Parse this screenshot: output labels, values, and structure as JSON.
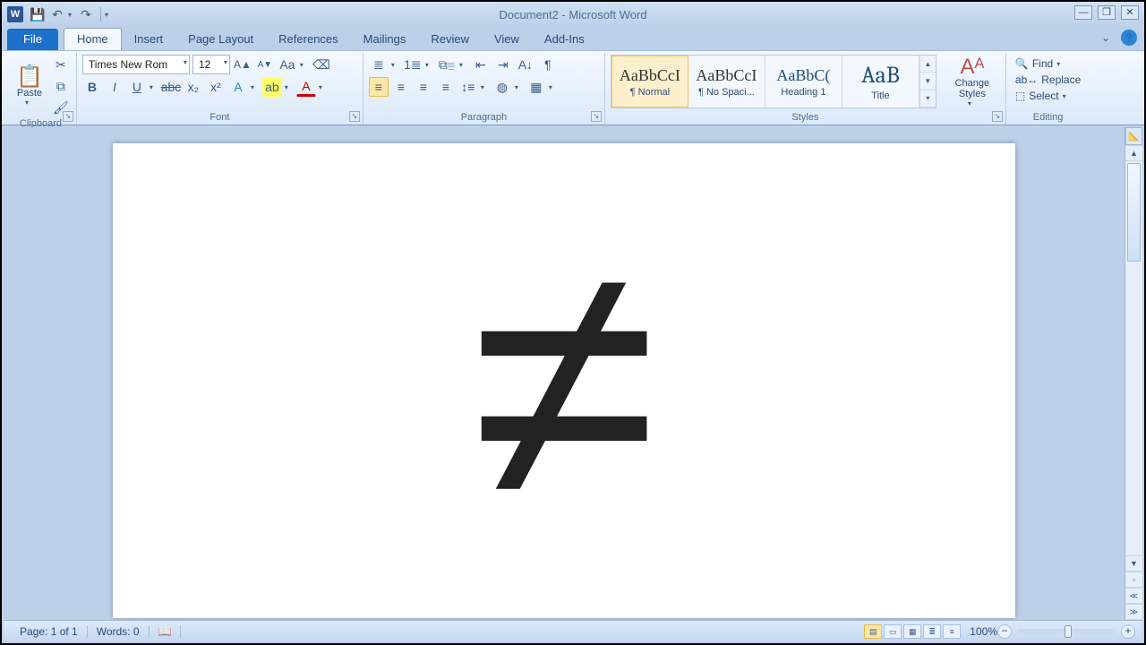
{
  "title": "Document2  -  Microsoft Word",
  "tabs": {
    "file": "File",
    "items": [
      "Home",
      "Insert",
      "Page Layout",
      "References",
      "Mailings",
      "Review",
      "View",
      "Add-Ins"
    ],
    "active": 0
  },
  "ribbon": {
    "clipboard": {
      "paste": "Paste",
      "label": "Clipboard"
    },
    "font": {
      "name": "Times New Rom",
      "size": "12",
      "label": "Font"
    },
    "paragraph": {
      "label": "Paragraph"
    },
    "styles": {
      "label": "Styles",
      "change": "Change Styles",
      "items": [
        {
          "sample": "AaBbCcI",
          "name": "¶ Normal"
        },
        {
          "sample": "AaBbCcI",
          "name": "¶ No Spaci..."
        },
        {
          "sample": "AaBbC(",
          "name": "Heading 1"
        },
        {
          "sample": "AaB",
          "name": "Title"
        }
      ]
    },
    "editing": {
      "find": "Find",
      "replace": "Replace",
      "select": "Select",
      "label": "Editing"
    }
  },
  "document": {
    "content_symbol": "≠"
  },
  "status": {
    "page": "Page: 1 of 1",
    "words": "Words: 0",
    "zoom": "100%"
  }
}
